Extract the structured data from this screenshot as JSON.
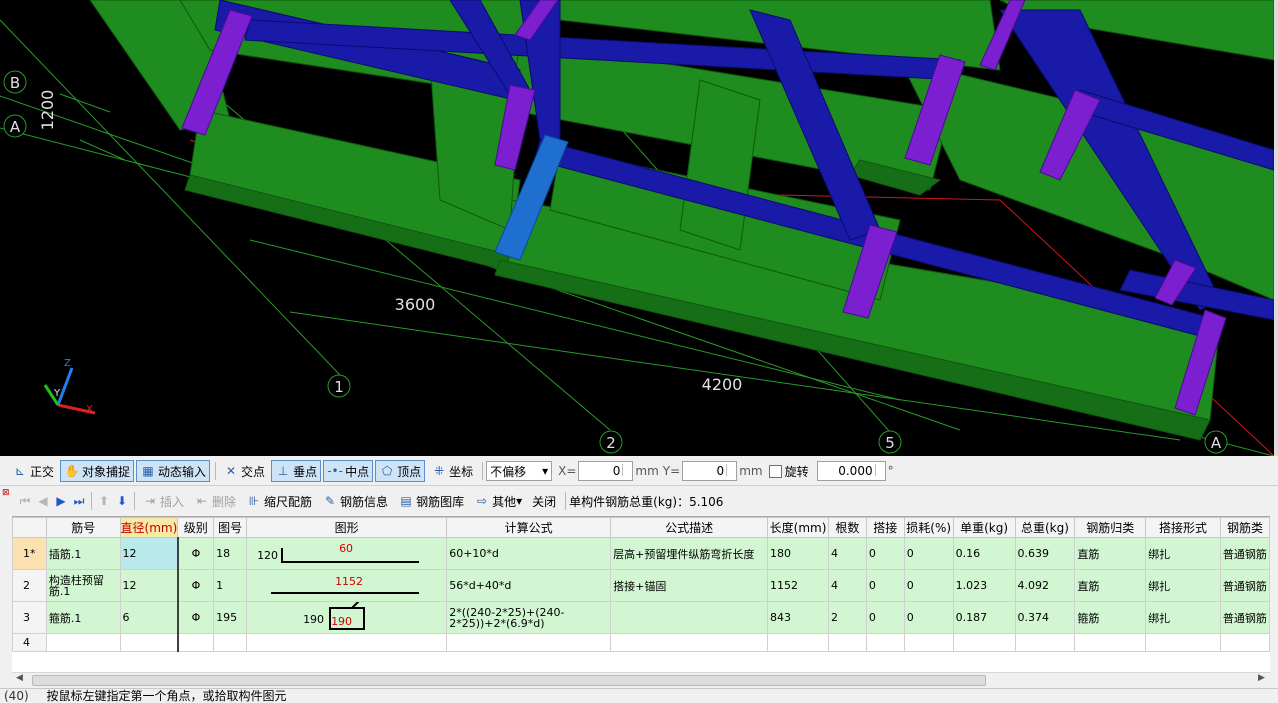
{
  "viewport": {
    "grid_labels": {
      "axis_b": "B",
      "axis_a_left": "A",
      "axis_1": "1",
      "axis_2": "2",
      "axis_5": "5",
      "axis_a_right": "A"
    },
    "dimensions": {
      "dim_1200": "1200",
      "dim_3600": "3600",
      "dim_4200": "4200"
    },
    "axes_gizmo": {
      "x": "X",
      "y": "Y",
      "z": "Z"
    },
    "colors": {
      "background": "#000000",
      "beam_green": "#1e8c1e",
      "beam_blue": "#1a1aa8",
      "column_purple": "#7b1fd0",
      "column_selected": "#1e6fd0",
      "grid_line": "#2a9a2a",
      "red_line": "#d01818"
    }
  },
  "snapbar": {
    "ortho": "正交",
    "object_snap": "对象捕捉",
    "dynamic_input": "动态输入",
    "intersection": "交点",
    "perpendicular": "垂点",
    "midpoint": "中点",
    "vertex": "顶点",
    "coordinate": "坐标",
    "offset_value": "不偏移",
    "x_label": "X=",
    "x_value": "0",
    "unit1": "mm",
    "y_label": "Y=",
    "y_value": "0",
    "unit2": "mm",
    "rotate_label": "旋转",
    "rotate_value": "0.000",
    "degree": "°"
  },
  "gridbar": {
    "insert": "插入",
    "delete": "删除",
    "scale_rebar": "缩尺配筋",
    "rebar_info": "钢筋信息",
    "rebar_library": "钢筋图库",
    "other": "其他",
    "close": "关闭",
    "total_weight": "单构件钢筋总重(kg)：5.106"
  },
  "table": {
    "headers": [
      "筋号",
      "直径(mm)",
      "级别",
      "图号",
      "图形",
      "计算公式",
      "公式描述",
      "长度(mm)",
      "根数",
      "搭接",
      "损耗(%)",
      "单重(kg)",
      "总重(kg)",
      "钢筋归类",
      "搭接形式",
      "钢筋类"
    ],
    "rows": [
      {
        "rn": "1*",
        "name": "插筋.1",
        "dia": "12",
        "grade": "Φ",
        "fig": "18",
        "shape_left": "120",
        "shape_top": "60",
        "formula": "60+10*d",
        "desc": "层高+预留埋件纵筋弯折长度",
        "len": "180",
        "count": "4",
        "lap": "0",
        "loss": "0",
        "unit_w": "0.16",
        "total_w": "0.639",
        "cat": "直筋",
        "lap_type": "绑扎",
        "type": "普通钢筋"
      },
      {
        "rn": "2",
        "name": "构造柱预留筋.1",
        "dia": "12",
        "grade": "Φ",
        "fig": "1",
        "shape_left": "",
        "shape_top": "1152",
        "formula": "56*d+40*d",
        "desc": "搭接+锚固",
        "len": "1152",
        "count": "4",
        "lap": "0",
        "loss": "0",
        "unit_w": "1.023",
        "total_w": "4.092",
        "cat": "直筋",
        "lap_type": "绑扎",
        "type": "普通钢筋"
      },
      {
        "rn": "3",
        "name": "箍筋.1",
        "dia": "6",
        "grade": "Φ",
        "fig": "195",
        "shape_left": "190",
        "shape_top": "190",
        "formula": "2*((240-2*25)+(240-2*25))+2*(6.9*d)",
        "desc": "",
        "len": "843",
        "count": "2",
        "lap": "0",
        "loss": "0",
        "unit_w": "0.187",
        "total_w": "0.374",
        "cat": "箍筋",
        "lap_type": "绑扎",
        "type": "普通钢筋"
      },
      {
        "rn": "4",
        "name": "",
        "dia": "",
        "grade": "",
        "fig": "",
        "shape_left": "",
        "shape_top": "",
        "formula": "",
        "desc": "",
        "len": "",
        "count": "",
        "lap": "",
        "loss": "",
        "unit_w": "",
        "total_w": "",
        "cat": "",
        "lap_type": "",
        "type": ""
      }
    ]
  },
  "status": {
    "code": "(40)",
    "message": "按鼠标左键指定第一个角点，或拾取构件图元"
  }
}
